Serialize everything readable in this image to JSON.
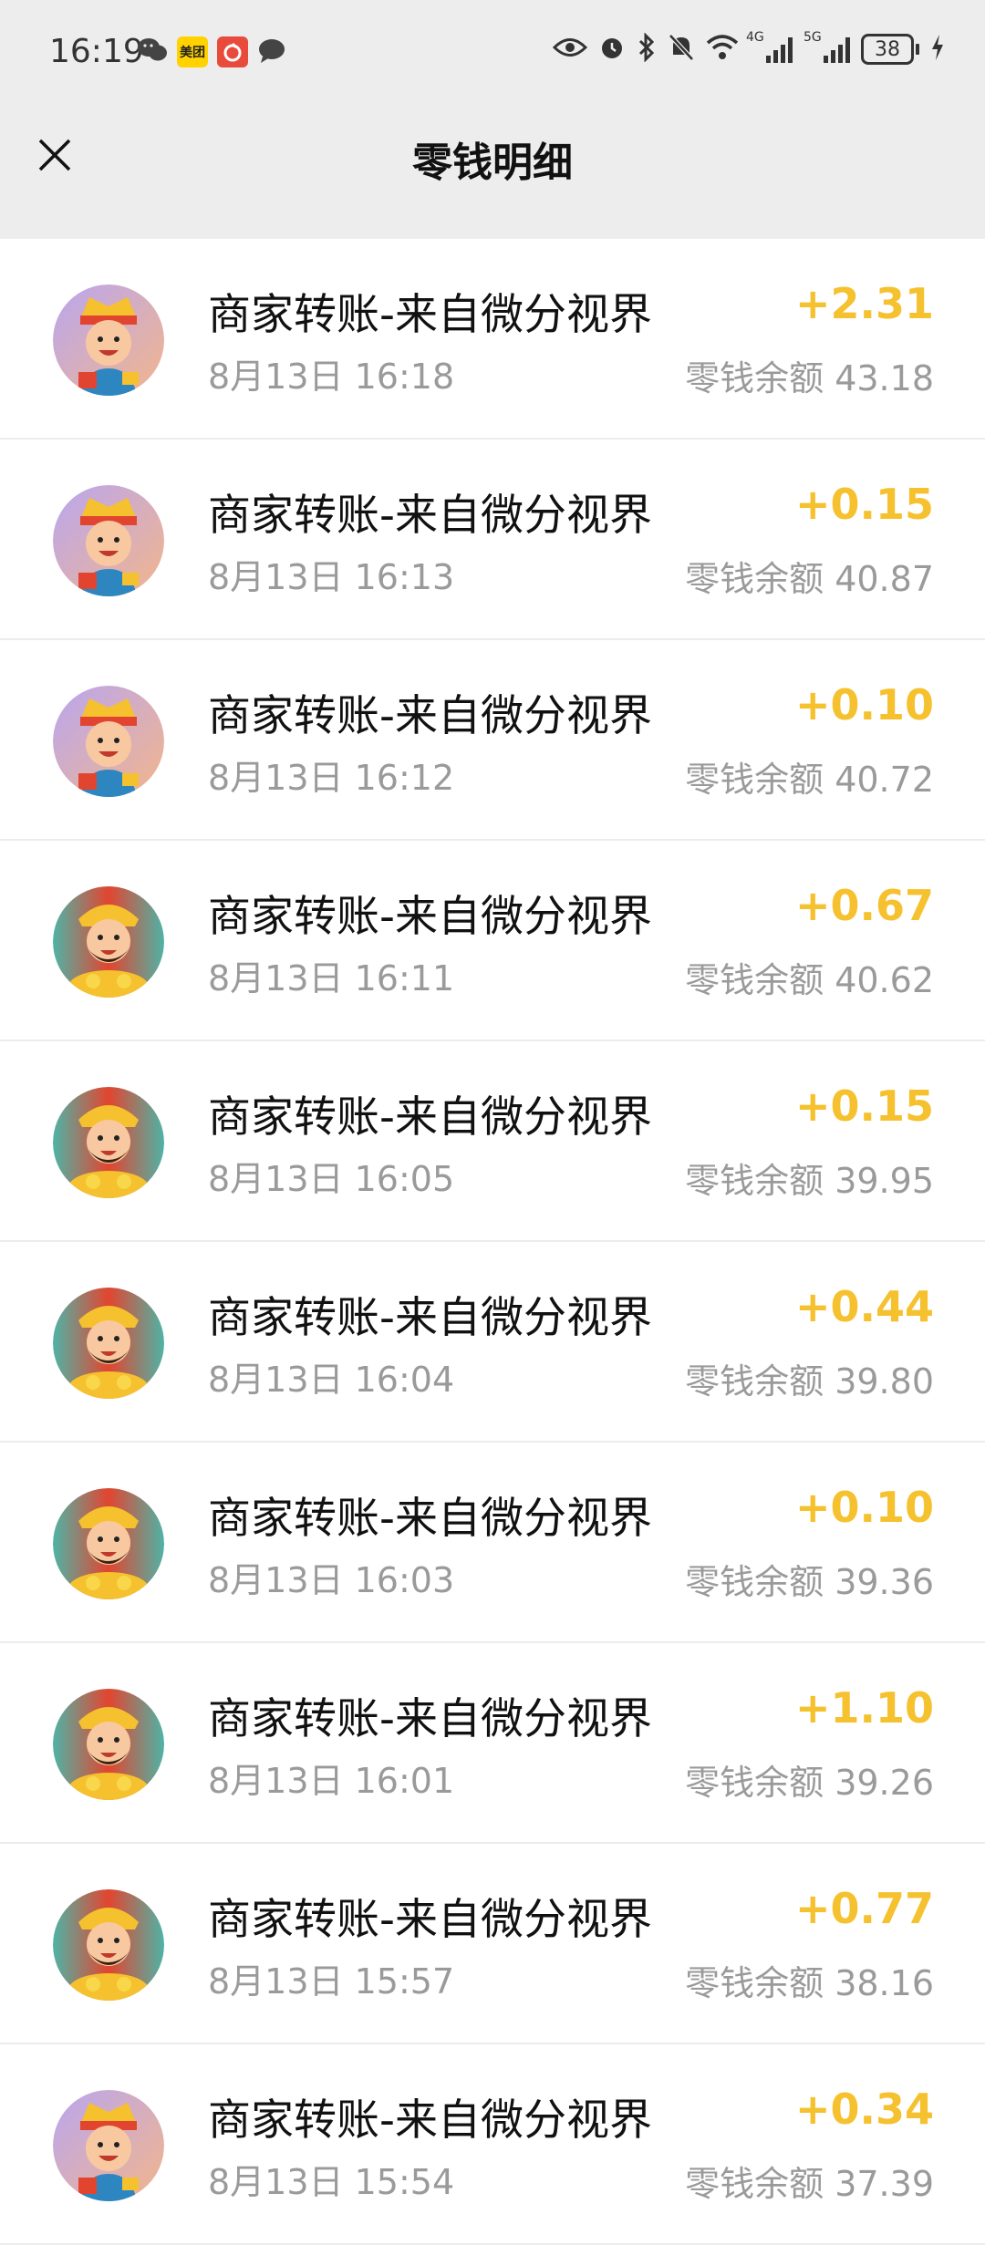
{
  "status_bar": {
    "time": "16:19",
    "left_icons": [
      "wechat-icon",
      "meituan-icon",
      "red-app-icon",
      "message-icon"
    ],
    "meituan_label": "美团",
    "network_1": "4G",
    "network_2": "5G",
    "battery": "38"
  },
  "nav": {
    "title": "零钱明细",
    "close_icon": "close-icon"
  },
  "colors": {
    "amount": "#f5c12e",
    "background": "#ededed"
  },
  "transactions": [
    {
      "title": "商家转账-来自微分视界",
      "time": "8月13日 16:18",
      "amount": "+2.31",
      "balance": "零钱余额 43.18",
      "avatar": "god-of-wealth-avatar-a"
    },
    {
      "title": "商家转账-来自微分视界",
      "time": "8月13日 16:13",
      "amount": "+0.15",
      "balance": "零钱余额 40.87",
      "avatar": "god-of-wealth-avatar-a"
    },
    {
      "title": "商家转账-来自微分视界",
      "time": "8月13日 16:12",
      "amount": "+0.10",
      "balance": "零钱余额 40.72",
      "avatar": "god-of-wealth-avatar-a"
    },
    {
      "title": "商家转账-来自微分视界",
      "time": "8月13日 16:11",
      "amount": "+0.67",
      "balance": "零钱余额 40.62",
      "avatar": "god-of-wealth-avatar-b"
    },
    {
      "title": "商家转账-来自微分视界",
      "time": "8月13日 16:05",
      "amount": "+0.15",
      "balance": "零钱余额 39.95",
      "avatar": "god-of-wealth-avatar-b"
    },
    {
      "title": "商家转账-来自微分视界",
      "time": "8月13日 16:04",
      "amount": "+0.44",
      "balance": "零钱余额 39.80",
      "avatar": "god-of-wealth-avatar-b"
    },
    {
      "title": "商家转账-来自微分视界",
      "time": "8月13日 16:03",
      "amount": "+0.10",
      "balance": "零钱余额 39.36",
      "avatar": "god-of-wealth-avatar-b"
    },
    {
      "title": "商家转账-来自微分视界",
      "time": "8月13日 16:01",
      "amount": "+1.10",
      "balance": "零钱余额 39.26",
      "avatar": "god-of-wealth-avatar-b"
    },
    {
      "title": "商家转账-来自微分视界",
      "time": "8月13日 15:57",
      "amount": "+0.77",
      "balance": "零钱余额 38.16",
      "avatar": "god-of-wealth-avatar-b"
    },
    {
      "title": "商家转账-来自微分视界",
      "time": "8月13日 15:54",
      "amount": "+0.34",
      "balance": "零钱余额 37.39",
      "avatar": "god-of-wealth-avatar-a"
    }
  ]
}
